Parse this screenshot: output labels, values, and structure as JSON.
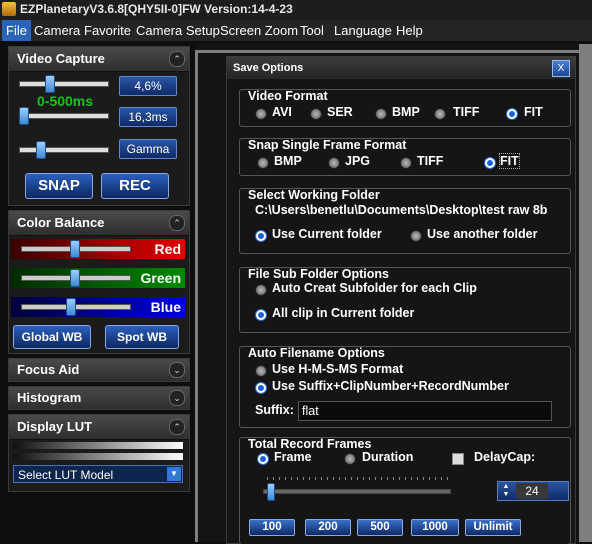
{
  "window": {
    "title": "EZPlanetaryV3.6.8[QHY5II-0]FW Version:14-4-23"
  },
  "menubar": {
    "items": [
      "File",
      "Camera",
      "Favorite",
      "Camera Setup",
      "Screen Zoom",
      "Tool",
      "Language",
      "Help"
    ]
  },
  "video_capture": {
    "title": "Video Capture",
    "gain_value": "4,6%",
    "range_label": "0-500ms",
    "exposure_value": "16,3ms",
    "gamma_label": "Gamma",
    "snap_label": "SNAP",
    "rec_label": "REC",
    "gain_level": 0.3,
    "exposure_level": 0.02,
    "gamma_level": 0.22
  },
  "color_balance": {
    "title": "Color Balance",
    "red_label": "Red",
    "green_label": "Green",
    "blue_label": "Blue",
    "red_level": 0.45,
    "green_level": 0.45,
    "blue_level": 0.42,
    "global_wb_label": "Global WB",
    "spot_wb_label": "Spot WB"
  },
  "focus_aid": {
    "title": "Focus Aid"
  },
  "histogram": {
    "title": "Histogram"
  },
  "display_lut": {
    "title": "Display LUT",
    "select_value": "Select LUT Model"
  },
  "dialog": {
    "title": "Save Options",
    "video_format": {
      "title": "Video Format",
      "options": [
        "AVI",
        "SER",
        "BMP",
        "TIFF",
        "FIT"
      ],
      "selected": "FIT"
    },
    "snap_format": {
      "title": "Snap Single Frame Format",
      "options": [
        "BMP",
        "JPG",
        "TIFF",
        "FIT"
      ],
      "selected": "FIT"
    },
    "working_folder": {
      "title": "Select Working Folder",
      "path": "C:\\Users\\benetlu\\Documents\\Desktop\\test raw 8b",
      "use_current": "Use Current folder",
      "use_another": "Use another folder",
      "selected": "use_current"
    },
    "sub_folder": {
      "title": "File Sub Folder Options",
      "auto_create": "Auto Creat Subfolder for each Clip",
      "all_current": "All clip in Current folder",
      "selected": "all_current"
    },
    "auto_filename": {
      "title": "Auto Filename Options",
      "hms": "Use H-M-S-MS Format",
      "suffix_clip": "Use Suffix+ClipNumber+RecordNumber",
      "selected": "suffix_clip",
      "suffix_label": "Suffix:",
      "suffix_value": "flat"
    },
    "total_frames": {
      "title": "Total Record Frames",
      "frame_label": "Frame",
      "duration_label": "Duration",
      "delaycap_label": "DelayCap:",
      "selected": "frame",
      "spin_value": "24",
      "slider_level": 0.02,
      "presets": [
        "100",
        "200",
        "500",
        "1000",
        "Unlimit"
      ]
    }
  }
}
